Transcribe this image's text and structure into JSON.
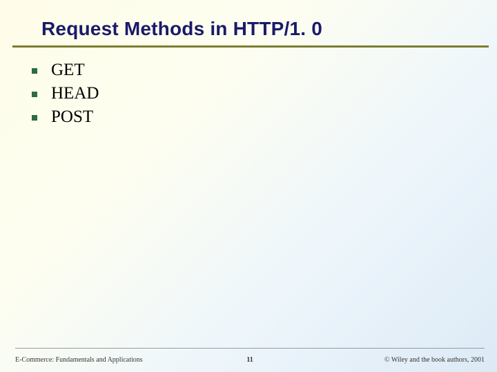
{
  "slide": {
    "title": "Request Methods in HTTP/1. 0",
    "bullets": [
      "GET",
      "HEAD",
      "POST"
    ]
  },
  "footer": {
    "left": "E-Commerce: Fundamentals and Applications",
    "center": "11",
    "right": "©  Wiley and the book authors, 2001"
  }
}
